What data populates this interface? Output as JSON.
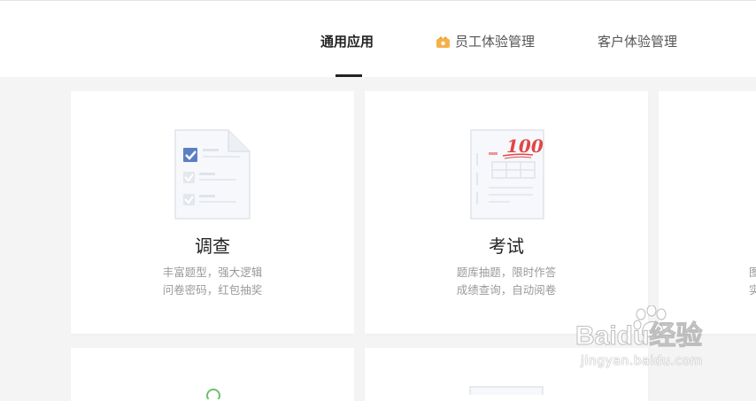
{
  "tabs": [
    {
      "label": "通用应用",
      "active": true
    },
    {
      "label": "员工体验管理",
      "active": false,
      "icon": "crown-icon"
    },
    {
      "label": "客户体验管理",
      "active": false
    }
  ],
  "cards": [
    {
      "title": "调查",
      "desc": [
        "丰富题型，强大逻辑",
        "问卷密码，红包抽奖"
      ],
      "icon": "survey-checklist-icon"
    },
    {
      "title": "考试",
      "desc": [
        "题库抽题，限时作答",
        "成绩查询，自动阅卷"
      ],
      "icon": "exam-paper-icon",
      "score": "100"
    },
    {
      "title": "",
      "desc": [
        "图",
        "实"
      ]
    },
    {
      "icon": "green-circle-icon"
    },
    {
      "icon": "document-icon"
    }
  ],
  "watermark": {
    "brand": "Baidu经验",
    "url": "jingyan.baidu.com"
  },
  "colors": {
    "accent": "#222222",
    "check_blue": "#5b7fc4",
    "score_red": "#e04747",
    "crown": "#f0a030"
  }
}
